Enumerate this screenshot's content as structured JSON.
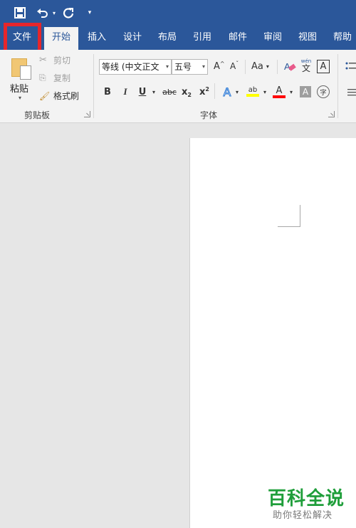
{
  "quick_access": {
    "save_icon": "save-icon",
    "undo_icon": "undo-icon",
    "redo_icon": "redo-icon",
    "customize_icon": "customize-qat-icon"
  },
  "tabs": [
    {
      "label": "文件"
    },
    {
      "label": "开始"
    },
    {
      "label": "插入"
    },
    {
      "label": "设计"
    },
    {
      "label": "布局"
    },
    {
      "label": "引用"
    },
    {
      "label": "邮件"
    },
    {
      "label": "审阅"
    },
    {
      "label": "视图"
    },
    {
      "label": "帮助"
    }
  ],
  "clipboard": {
    "paste_label": "粘贴",
    "cut_label": "剪切",
    "copy_label": "复制",
    "format_painter_label": "格式刷",
    "group_label": "剪贴板"
  },
  "font": {
    "font_name": "等线 (中文正文",
    "font_size": "五号",
    "grow_label": "A",
    "shrink_label": "A",
    "case_label": "Aa",
    "phonetic_top": "wén",
    "phonetic_bottom": "文",
    "border_char": "A",
    "bold": "B",
    "italic": "I",
    "underline": "U",
    "strike": "abc",
    "subscript": "x",
    "subscript_mark": "2",
    "superscript": "x",
    "superscript_mark": "2",
    "effects": "A",
    "highlight": "ab",
    "color": "A",
    "shading": "A",
    "enclose": "字",
    "group_label": "字体"
  },
  "colors": {
    "ribbon_blue": "#2b579a",
    "highlight_red": "#e6262b",
    "highlight_yellow": "#ffff00",
    "font_red": "#ff0000"
  },
  "watermark": {
    "main": "百科全说",
    "sub": "助你轻松解决"
  }
}
